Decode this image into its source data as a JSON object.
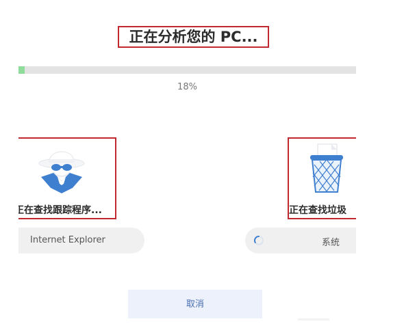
{
  "header": {
    "title": "正在分析您的 PC..."
  },
  "progress": {
    "fraction": 0.018,
    "percent_label": "18%",
    "fill_color": "#90dc9a",
    "track_color": "#e3e3e3"
  },
  "cards": [
    {
      "icon": "spy-icon",
      "label": "正在查找跟踪程序...",
      "status_text": "Internet Explorer",
      "highlighted": true
    },
    {
      "icon": "recycle-bin-icon",
      "label": "正在查找垃圾",
      "status_text": "系统",
      "status_icon": "loading-spinner-icon",
      "highlighted": true
    }
  ],
  "footer": {
    "cancel_label": "取消"
  },
  "colors": {
    "highlight_border": "#c0282e",
    "accent_blue": "#3f7fcf",
    "cancel_background": "#edf1fb"
  }
}
